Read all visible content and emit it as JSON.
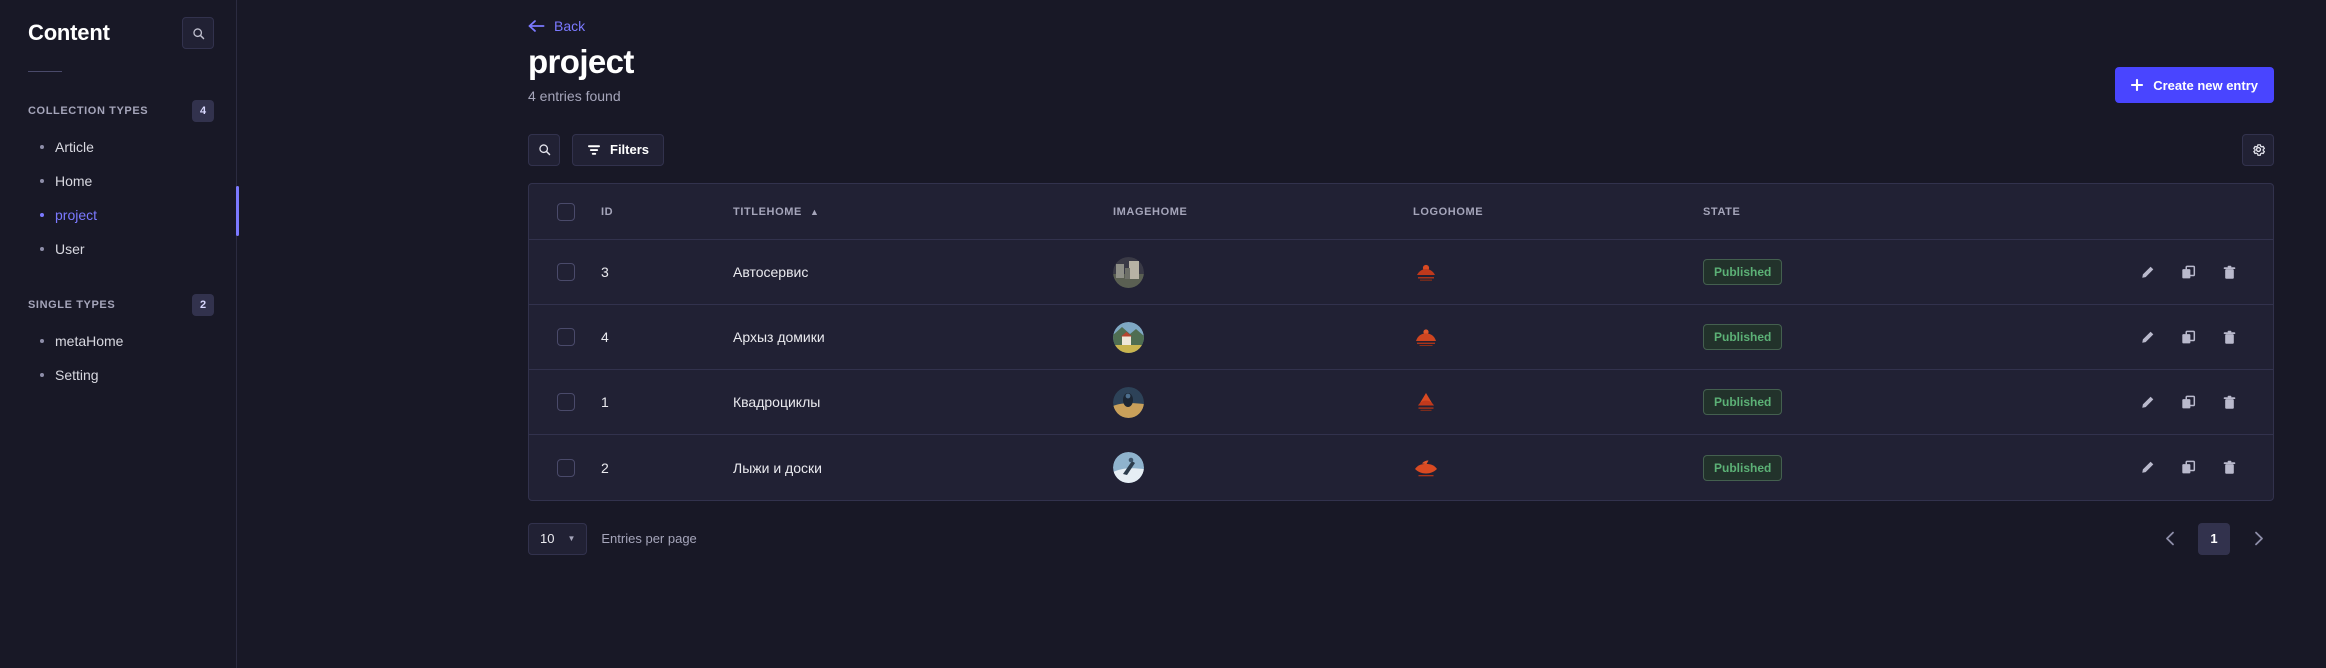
{
  "sidebar": {
    "title": "Content",
    "search_icon": "search-icon",
    "groups": [
      {
        "label": "COLLECTION TYPES",
        "count": "4",
        "items": [
          {
            "label": "Article",
            "active": false
          },
          {
            "label": "Home",
            "active": false
          },
          {
            "label": "project",
            "active": true
          },
          {
            "label": "User",
            "active": false
          }
        ]
      },
      {
        "label": "SINGLE TYPES",
        "count": "2",
        "items": [
          {
            "label": "metaHome",
            "active": false
          },
          {
            "label": "Setting",
            "active": false
          }
        ]
      }
    ]
  },
  "header": {
    "back_label": "Back",
    "back_icon": "arrow-left-icon",
    "title": "project",
    "subtitle": "4 entries found",
    "create_label": "Create new entry",
    "create_icon": "plus-icon"
  },
  "toolbar": {
    "search_icon": "search-icon",
    "filters_label": "Filters",
    "filters_icon": "filter-icon",
    "settings_icon": "gear-icon"
  },
  "table": {
    "columns": [
      "ID",
      "TITLEHOME",
      "IMAGEHOME",
      "LOGOHOME",
      "STATE"
    ],
    "sorted_column": "TITLEHOME",
    "sort_direction": "asc",
    "rows": [
      {
        "id": "3",
        "titlehome": "Автосервис",
        "state": "Published"
      },
      {
        "id": "4",
        "titlehome": "Архыз домики",
        "state": "Published"
      },
      {
        "id": "1",
        "titlehome": "Квадроциклы",
        "state": "Published"
      },
      {
        "id": "2",
        "titlehome": "Лыжи и доски",
        "state": "Published"
      }
    ],
    "action_icons": [
      "pencil-icon",
      "duplicate-icon",
      "trash-icon"
    ]
  },
  "footer": {
    "per_page_value": "10",
    "per_page_label": "Entries per page",
    "current_page": "1",
    "prev_icon": "chevron-left-icon",
    "next_icon": "chevron-right-icon"
  },
  "colors": {
    "accent": "#4945ff",
    "accent_link": "#7b79ff",
    "published": "#5cb176",
    "page_bg": "#181826",
    "panel_bg": "#212134",
    "border": "#32324d"
  }
}
